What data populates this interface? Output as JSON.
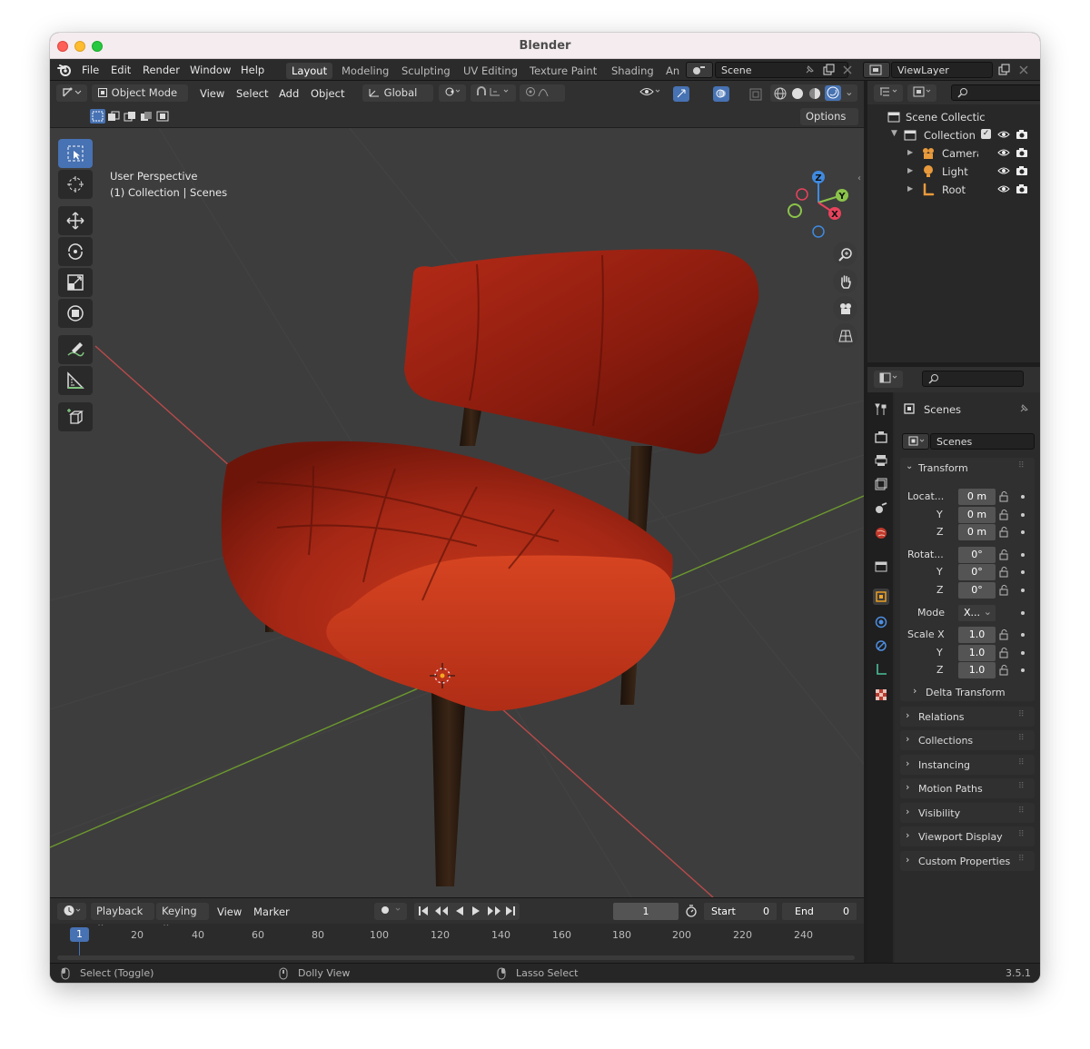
{
  "window": {
    "title": "Blender"
  },
  "menu": [
    "File",
    "Edit",
    "Render",
    "Window",
    "Help"
  ],
  "workspaces": [
    "Layout",
    "Modeling",
    "Sculpting",
    "UV Editing",
    "Texture Paint",
    "Shading",
    "An"
  ],
  "scene_selector": {
    "value": "Scene"
  },
  "viewlayer_selector": {
    "value": "ViewLayer"
  },
  "viewport_header": {
    "mode": "Object Mode",
    "menus": [
      "View",
      "Select",
      "Add",
      "Object"
    ],
    "orientation": "Global",
    "options_label": "Options"
  },
  "viewport_overlay": {
    "line1": "User Perspective",
    "line2": "(1) Collection | Scenes"
  },
  "gizmo": {
    "x": "X",
    "y": "Y",
    "z": "Z"
  },
  "outliner": {
    "rows": [
      {
        "label": "Scene Collectic",
        "icon": "collection-icon"
      },
      {
        "label": "Collection",
        "icon": "collection-icon"
      },
      {
        "label": "Camera",
        "icon": "camera-icon"
      },
      {
        "label": "Light",
        "icon": "light-icon"
      },
      {
        "label": "Root",
        "icon": "armature-icon"
      }
    ]
  },
  "properties": {
    "context_label": "Scenes",
    "object_name": "Scenes",
    "transform_title": "Transform",
    "location": {
      "label": "Locat...",
      "x": "0 m",
      "y": "0 m",
      "z": "0 m"
    },
    "rotation": {
      "label": "Rotat...",
      "x": "0°",
      "y": "0°",
      "z": "0°"
    },
    "mode": {
      "label": "Mode",
      "value": "X..."
    },
    "scale": {
      "label": "Scale X",
      "x": "1.0",
      "y": "1.0",
      "z": "1.0"
    },
    "axis_y": "Y",
    "axis_z": "Z",
    "delta_transform": "Delta Transform",
    "subpanels": [
      "Relations",
      "Collections",
      "Instancing",
      "Motion Paths",
      "Visibility",
      "Viewport Display",
      "Custom Properties"
    ]
  },
  "timeline": {
    "menus": [
      "Playback",
      "Keying",
      "View",
      "Marker"
    ],
    "current_frame": "1",
    "start_label": "Start",
    "start_value": "0",
    "end_label": "End",
    "end_value": "0",
    "ruler": [
      "20",
      "40",
      "60",
      "80",
      "100",
      "120",
      "140",
      "160",
      "180",
      "200",
      "220",
      "240"
    ],
    "playhead": "1"
  },
  "statusbar": {
    "select": "Select (Toggle)",
    "dolly": "Dolly View",
    "lasso": "Lasso Select",
    "version": "3.5.1"
  },
  "colors": {
    "accent": "#4772b3",
    "chair_fabric": "#b02a16",
    "chair_legs": "#2b1a10",
    "x_axis": "#e8435c",
    "y_axis": "#8bc34a",
    "z_axis": "#3f8ae0"
  }
}
